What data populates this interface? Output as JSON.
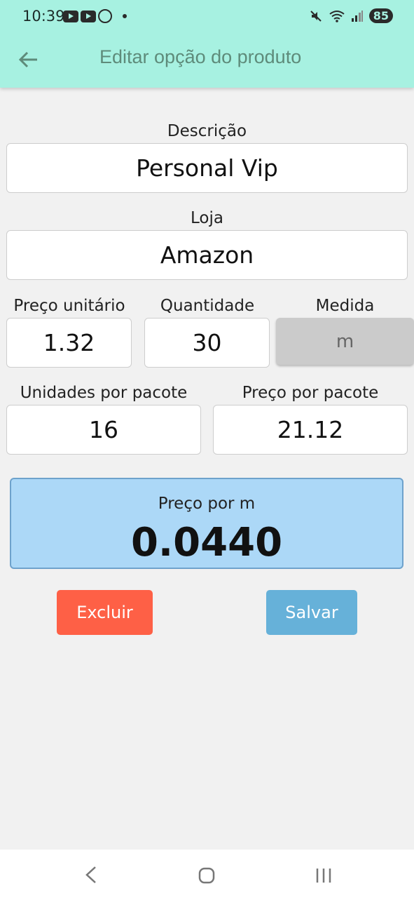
{
  "status_bar": {
    "time": "10:39",
    "battery": "85",
    "app_icons": [
      "youtube-icon",
      "youtube-icon",
      "whatsapp-icon"
    ],
    "right_icons": [
      "mute-icon",
      "wifi-icon",
      "signal-icon"
    ]
  },
  "app_bar": {
    "title": "Editar opção do produto",
    "back_icon": "arrow-left-icon"
  },
  "form": {
    "description_label": "Descrição",
    "description_value": "Personal Vip",
    "store_label": "Loja",
    "store_value": "Amazon",
    "unit_price_label": "Preço unitário",
    "unit_price_value": "1.32",
    "quantity_label": "Quantidade",
    "quantity_value": "30",
    "measure_label": "Medida",
    "measure_value": "m",
    "units_per_pack_label": "Unidades por pacote",
    "units_per_pack_value": "16",
    "price_per_pack_label": "Preço por pacote",
    "price_per_pack_value": "21.12"
  },
  "result": {
    "label": "Preço por m",
    "value": "0.0440"
  },
  "buttons": {
    "delete": "Excluir",
    "save": "Salvar"
  },
  "colors": {
    "app_bar": "#a7f1e1",
    "delete": "#fe6046",
    "save": "#66b1d9",
    "result_bg": "#acd8f7"
  },
  "nav_bar": {
    "icons": [
      "back-nav-icon",
      "home-nav-icon",
      "recents-nav-icon"
    ]
  }
}
